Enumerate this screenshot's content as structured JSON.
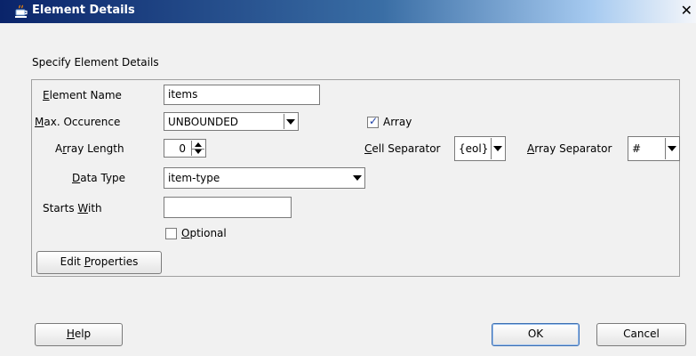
{
  "window": {
    "title": "Element Details",
    "close_glyph": "✕"
  },
  "form": {
    "heading": "Specify Element Details",
    "element_name": {
      "label": "Element Name",
      "value": "items"
    },
    "max_occurence": {
      "label": "Max. Occurence",
      "value": "UNBOUNDED"
    },
    "array_checkbox": {
      "label": "Array",
      "checked": true
    },
    "array_length": {
      "label": "Array Length",
      "value": "0"
    },
    "cell_separator": {
      "label": "Cell Separator",
      "value": "{eol}"
    },
    "array_separator": {
      "label": "Array Separator",
      "value": "#"
    },
    "data_type": {
      "label": "Data Type",
      "value": "item-type"
    },
    "starts_with": {
      "label": "Starts With",
      "value": ""
    },
    "optional_checkbox": {
      "label": "Optional",
      "checked": false
    },
    "edit_properties_label": "Edit Properties"
  },
  "buttons": {
    "help": "Help",
    "ok": "OK",
    "cancel": "Cancel"
  },
  "colors": {
    "titlebar_start": "#0a246a",
    "titlebar_end": "#a6caf0",
    "dialog_bg": "#f1f1f1"
  },
  "icons": {
    "title": "coffee-cup-icon",
    "close": "close-icon"
  }
}
